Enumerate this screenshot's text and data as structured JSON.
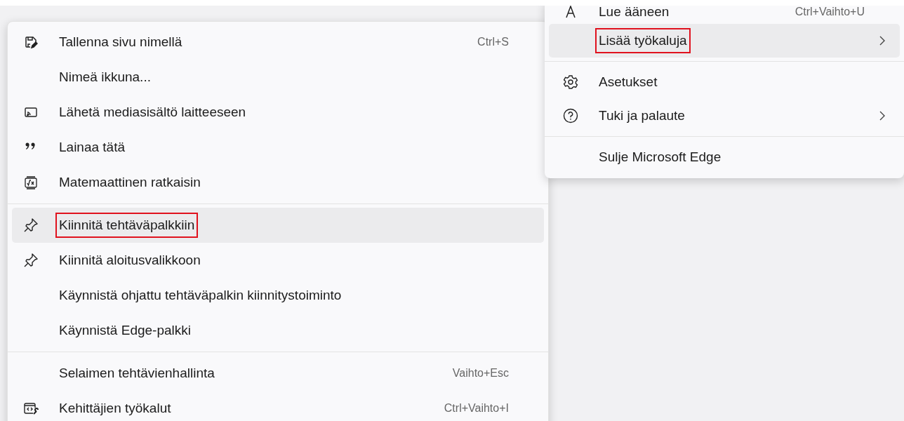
{
  "submenu": {
    "groups": [
      {
        "items": [
          {
            "kind": "save",
            "label": "Tallenna sivu nimellä",
            "shortcut": "Ctrl+S",
            "highlighted": false,
            "outlined": false
          },
          {
            "label": "Nimeä ikkuna...",
            "highlighted": false,
            "outlined": false
          },
          {
            "kind": "cast",
            "label": "Lähetä mediasisältö laitteeseen",
            "highlighted": false,
            "outlined": false
          },
          {
            "kind": "quote",
            "label": "Lainaa tätä",
            "highlighted": false,
            "outlined": false
          },
          {
            "kind": "math",
            "label": "Matemaattinen ratkaisin",
            "highlighted": false,
            "outlined": false
          }
        ]
      },
      {
        "items": [
          {
            "kind": "pin",
            "label": "Kiinnitä tehtäväpalkkiin",
            "highlighted": true,
            "outlined": true
          },
          {
            "kind": "pin",
            "label": "Kiinnitä aloitusvalikkoon",
            "highlighted": false,
            "outlined": false
          },
          {
            "label": "Käynnistä ohjattu tehtäväpalkin kiinnitystoiminto",
            "highlighted": false,
            "outlined": false
          },
          {
            "label": "Käynnistä Edge-palkki",
            "highlighted": false,
            "outlined": false
          }
        ]
      },
      {
        "items": [
          {
            "label": "Selaimen tehtävienhallinta",
            "shortcut": "Vaihto+Esc",
            "highlighted": false,
            "outlined": false
          },
          {
            "kind": "devtools",
            "label": "Kehittäjien työkalut",
            "shortcut": "Ctrl+Vaihto+I",
            "highlighted": false,
            "outlined": false
          }
        ]
      }
    ]
  },
  "main_menu": {
    "groups": [
      {
        "items": [
          {
            "kind": "read-aloud",
            "label": "Lue ääneen",
            "shortcut": "Ctrl+Vaihto+U",
            "highlighted": false,
            "outlined": false,
            "submenu": false
          },
          {
            "label": "Lisää työkaluja",
            "highlighted": true,
            "outlined": true,
            "submenu": true
          }
        ]
      },
      {
        "items": [
          {
            "kind": "gear",
            "label": "Asetukset",
            "highlighted": false,
            "outlined": false,
            "submenu": false
          },
          {
            "kind": "help",
            "label": "Tuki ja palaute",
            "highlighted": false,
            "outlined": false,
            "submenu": true
          }
        ]
      },
      {
        "items": [
          {
            "label": "Sulje Microsoft Edge",
            "highlighted": false,
            "outlined": false,
            "submenu": false
          }
        ]
      }
    ]
  }
}
